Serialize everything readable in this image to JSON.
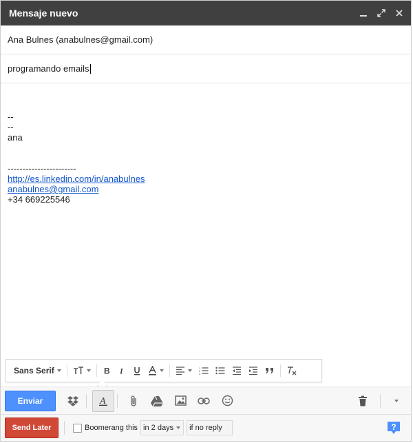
{
  "window": {
    "title": "Mensaje nuevo"
  },
  "compose": {
    "to": "Ana Bulnes (anabulnes@gmail.com)",
    "subject": "programando emails",
    "body": {
      "line1": "--",
      "line2": "--",
      "line3": "ana",
      "divider": "-----------------------",
      "link1": "http://es.linkedin.com/in/anabulnes",
      "link2": "anabulnes@gmail.com",
      "phone": "+34 669225546"
    }
  },
  "format_toolbar": {
    "font": "Sans Serif"
  },
  "toolbar": {
    "send_label": "Enviar"
  },
  "boomerang": {
    "send_later_label": "Send Later",
    "checkbox_label": "Boomerang this",
    "interval": "in 2 days",
    "condition": "if no reply"
  },
  "colors": {
    "send": "#4d90fe",
    "send_later": "#d14836",
    "titlebar": "#404040",
    "link": "#1155cc",
    "help": "#4d90fe"
  }
}
